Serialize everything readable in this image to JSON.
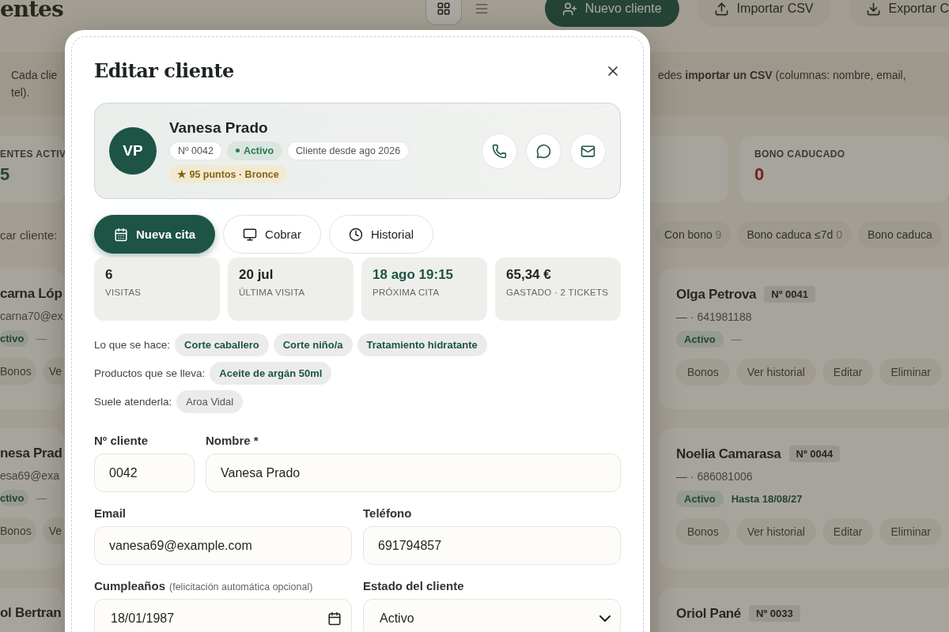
{
  "page": {
    "title": "entes",
    "view_toggle": [
      {
        "selected": true
      },
      {
        "selected": false
      }
    ],
    "actions": [
      {
        "label": "Nuevo cliente",
        "kind": "primary"
      },
      {
        "label": "Importar CSV",
        "kind": "secondary"
      },
      {
        "label": "Exportar C",
        "kind": "secondary"
      }
    ],
    "notice": {
      "left_lines": [
        "Cada clie",
        "tel)."
      ],
      "right": "edes **importar un CSV** (columnas: nombre, email,"
    },
    "stats": [
      {
        "label": "ENTES ACTIV",
        "value": "5",
        "kind": "count"
      },
      {
        "label": "BONO CADUCADO",
        "value": "0",
        "kind": "alert"
      }
    ],
    "search_label": "car cliente:",
    "filters": [
      {
        "label": "Con bono",
        "count": "9"
      },
      {
        "label": "Bono caduca ≤7d",
        "count": "0"
      },
      {
        "label": "Bono caduca"
      }
    ],
    "clients_left": [
      {
        "name": "carna Lóp",
        "contact": "carna70@ex",
        "status": "ctivo",
        "note": "—",
        "buttons": [
          "Bonos",
          "Ve"
        ]
      },
      {
        "name": "nesa Prad",
        "contact": "esa69@exa",
        "status": "ctivo",
        "note": "—",
        "buttons": [
          "Bonos",
          "Ve"
        ]
      },
      {
        "name": "ol Bertran"
      }
    ],
    "clients_right": [
      {
        "name": "Olga Petrova",
        "number": "Nº 0041",
        "contact": "— · 641981188",
        "status": "Activo",
        "note": {
          "text": "—",
          "kind": "plain"
        },
        "buttons": [
          "Bonos",
          "Ver historial",
          "Editar",
          "Eliminar"
        ]
      },
      {
        "name": "Noelia Camarasa",
        "number": "Nº 0044",
        "contact": "— · 686081006",
        "status": "Activo",
        "note": {
          "text": "Hasta 18/08/27",
          "kind": "expiry"
        },
        "buttons": [
          "Bonos",
          "Ver historial",
          "Editar",
          "Eliminar"
        ]
      },
      {
        "name": "Oriol Pané",
        "number": "Nº 0033"
      }
    ]
  },
  "modal": {
    "title": "Editar cliente",
    "profile": {
      "initials": "VP",
      "name": "Vanesa Prado",
      "chips": [
        {
          "text": "Nº 0042",
          "kind": "plain"
        },
        {
          "text": "Activo",
          "kind": "status"
        },
        {
          "text": "Cliente desde ago 2026",
          "kind": "plain"
        }
      ],
      "points": "★ 95 puntos · Bronce"
    },
    "actions": [
      {
        "label": "Nueva cita",
        "kind": "primary"
      },
      {
        "label": "Cobrar",
        "kind": "secondary"
      },
      {
        "label": "Historial",
        "kind": "secondary"
      }
    ],
    "stats": [
      {
        "value": "6",
        "label": "VISITAS",
        "highlight": false
      },
      {
        "value": "20 jul",
        "label": "ÚLTIMA VISITA",
        "highlight": false
      },
      {
        "value": "18 ago 19:15",
        "label": "PRÓXIMA CITA",
        "highlight": true
      },
      {
        "value": "65,34 €",
        "label": "GASTADO · 2 TICKETS",
        "highlight": false
      }
    ],
    "tag_groups": [
      {
        "label": "Lo que se hace:",
        "kind": "service",
        "tags": [
          "Corte caballero",
          "Corte niño/a",
          "Tratamiento hidratante"
        ]
      },
      {
        "label": "Productos que se lleva:",
        "kind": "service",
        "tags": [
          "Aceite de argán 50ml"
        ]
      },
      {
        "label": "Suele atenderla:",
        "kind": "staff",
        "tags": [
          "Aroa Vidal"
        ]
      }
    ],
    "form_rows": [
      [
        {
          "label": "Nº cliente",
          "value": "0042",
          "kind": "text",
          "narrow": true
        },
        {
          "label": "Nombre *",
          "value": "Vanesa Prado",
          "kind": "text",
          "narrow": false
        }
      ],
      [
        {
          "label": "Email",
          "value": "vanesa69@example.com",
          "kind": "text",
          "narrow": false
        },
        {
          "label": "Teléfono",
          "value": "691794857",
          "kind": "text",
          "narrow": false
        }
      ],
      [
        {
          "label": "Cumpleaños",
          "hint": "(felicitación automática opcional)",
          "value": "18/01/1987",
          "kind": "date",
          "narrow": false
        },
        {
          "label": "Estado del cliente",
          "value": "Activo",
          "kind": "select",
          "narrow": false
        }
      ]
    ]
  }
}
